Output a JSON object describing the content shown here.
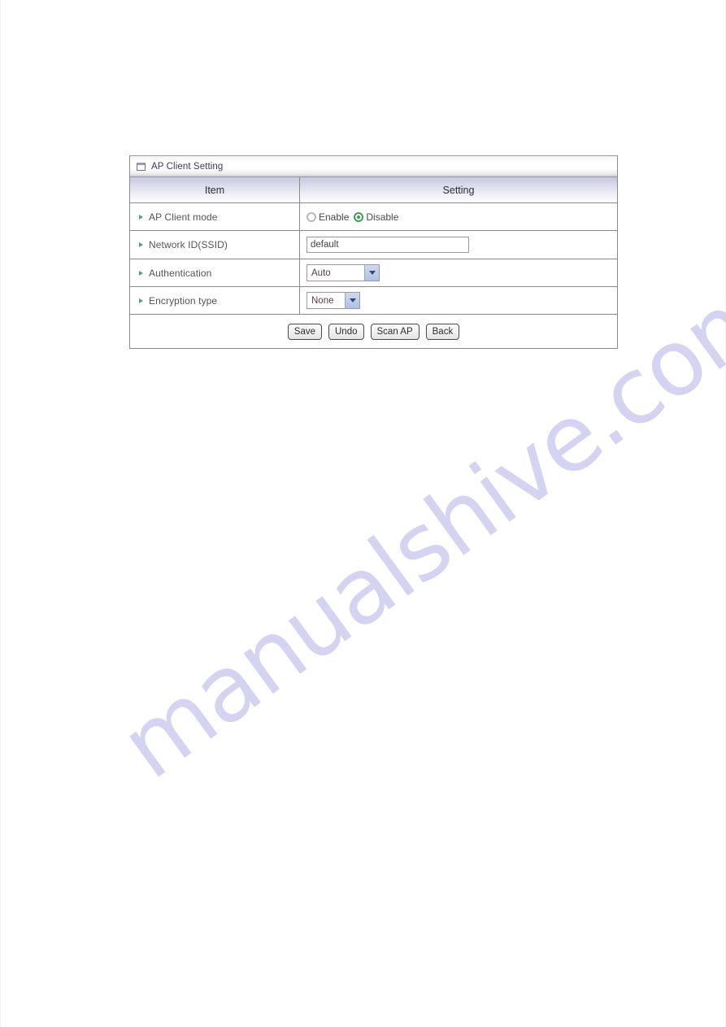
{
  "panel": {
    "title": "AP Client Setting",
    "title_icon": "window-icon",
    "columns": {
      "item": "Item",
      "setting": "Setting"
    },
    "rows": [
      {
        "label": "AP Client mode",
        "control": "radio-group",
        "options": [
          {
            "label": "Enable",
            "selected": false
          },
          {
            "label": "Disable",
            "selected": true
          }
        ]
      },
      {
        "label": "Network ID(SSID)",
        "control": "text-input",
        "value": "default",
        "placeholder": ""
      },
      {
        "label": "Authentication",
        "control": "select",
        "value": "Auto"
      },
      {
        "label": "Encryption type",
        "control": "select",
        "value": "None"
      }
    ],
    "buttons": [
      {
        "label": "Save"
      },
      {
        "label": "Undo"
      },
      {
        "label": "Scan AP"
      },
      {
        "label": "Back"
      }
    ]
  },
  "watermark": {
    "text": "manualshive.com",
    "color": "#c9c8ef"
  },
  "colors": {
    "bullet_green": "#3fa878",
    "radio_selected": "#36a04a",
    "header_lavender": "#c5c5dd",
    "select_arrow_blue": "#aec2e4",
    "panel_border": "#8a8a8a"
  }
}
